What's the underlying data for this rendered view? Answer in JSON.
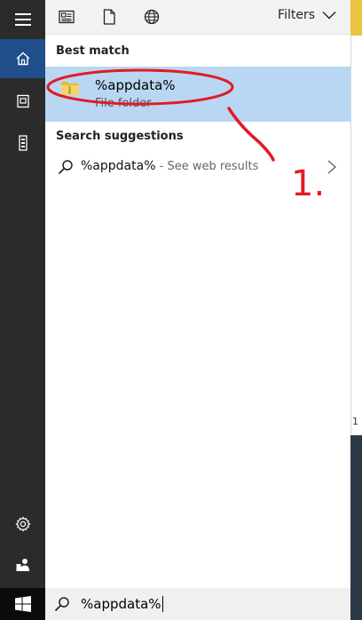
{
  "header": {
    "filters_label": "Filters"
  },
  "sections": {
    "best_match_label": "Best match",
    "suggestions_label": "Search suggestions"
  },
  "best_match": {
    "title": "%appdata%",
    "subtitle": "File folder",
    "icon": "folder-icon"
  },
  "suggestion": {
    "query": "%appdata%",
    "hint": " - See web results",
    "icon": "search-icon"
  },
  "search": {
    "value": "%appdata%"
  },
  "rail": {
    "items": [
      "hamburger-menu-icon",
      "home-icon",
      "documents-icon",
      "device-icon",
      "settings-icon",
      "user-icon",
      "windows-start-icon"
    ]
  },
  "annotation": {
    "label": "1."
  },
  "desktop_fragment": {
    "text": "1"
  },
  "colors": {
    "accent": "#1f4e8a",
    "selection": "#b9d7f2",
    "annotation": "#e01b24"
  }
}
